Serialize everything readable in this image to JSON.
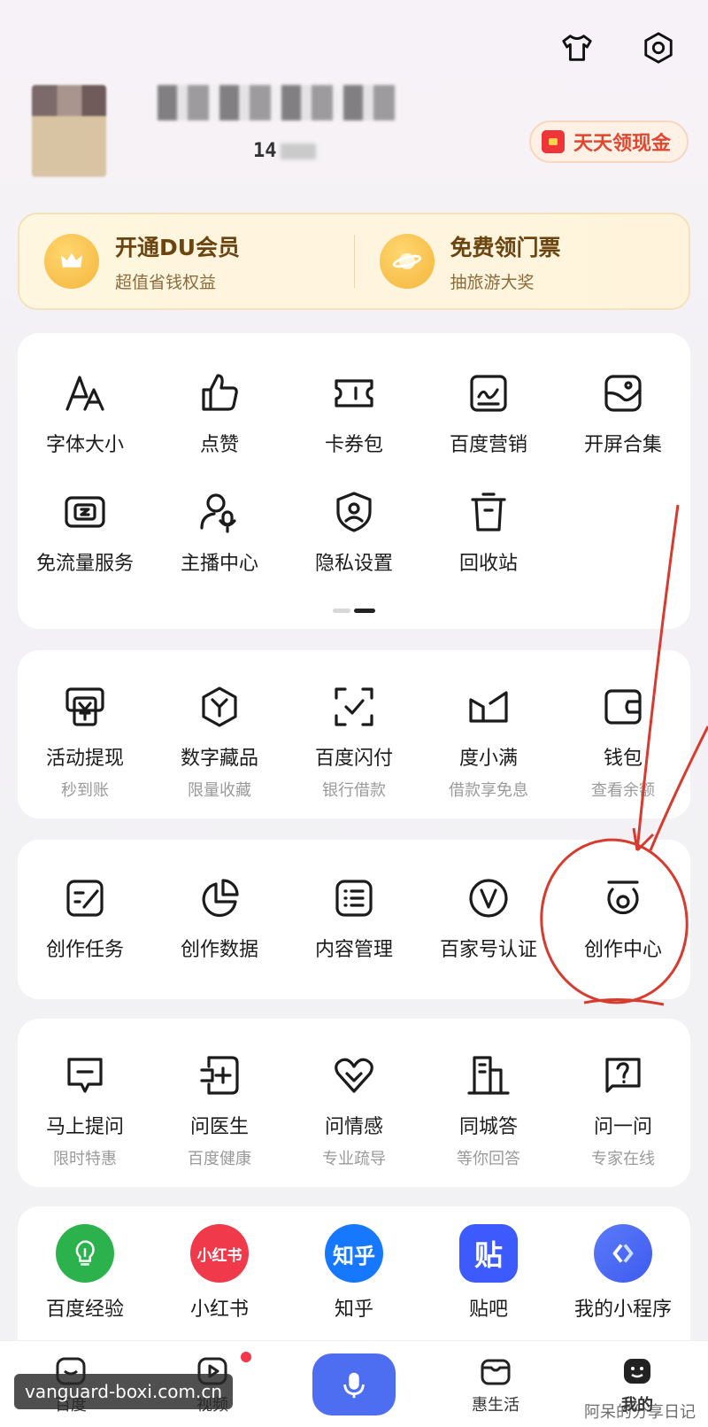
{
  "header": {
    "user_id": "14",
    "cash_button": "天天领现金"
  },
  "member": {
    "left": {
      "title": "开通DU会员",
      "subtitle": "超值省钱权益"
    },
    "right": {
      "title": "免费领门票",
      "subtitle": "抽旅游大奖"
    }
  },
  "tools": {
    "items": [
      {
        "label": "字体大小",
        "icon": "font-size-icon"
      },
      {
        "label": "点赞",
        "icon": "thumbs-up-icon"
      },
      {
        "label": "卡券包",
        "icon": "ticket-icon"
      },
      {
        "label": "百度营销",
        "icon": "marketing-icon"
      },
      {
        "label": "开屏合集",
        "icon": "splash-collection-icon"
      },
      {
        "label": "免流量服务",
        "icon": "free-data-icon"
      },
      {
        "label": "主播中心",
        "icon": "anchor-center-icon"
      },
      {
        "label": "隐私设置",
        "icon": "privacy-shield-icon"
      },
      {
        "label": "回收站",
        "icon": "trash-icon"
      }
    ]
  },
  "finance": {
    "items": [
      {
        "label": "活动提现",
        "sub": "秒到账",
        "icon": "withdraw-icon"
      },
      {
        "label": "数字藏品",
        "sub": "限量收藏",
        "icon": "digital-collectible-icon"
      },
      {
        "label": "百度闪付",
        "sub": "银行借款",
        "icon": "flash-pay-icon"
      },
      {
        "label": "度小满",
        "sub": "借款享免息",
        "icon": "duxiaoman-icon"
      },
      {
        "label": "钱包",
        "sub": "查看余额",
        "icon": "wallet-icon"
      }
    ]
  },
  "creator": {
    "items": [
      {
        "label": "创作任务",
        "icon": "creation-task-icon"
      },
      {
        "label": "创作数据",
        "icon": "creation-data-icon"
      },
      {
        "label": "内容管理",
        "icon": "content-management-icon"
      },
      {
        "label": "百家号认证",
        "icon": "baijiahao-verify-icon"
      },
      {
        "label": "创作中心",
        "icon": "creation-center-icon"
      }
    ]
  },
  "ask": {
    "items": [
      {
        "label": "马上提问",
        "sub": "限时特惠",
        "icon": "ask-now-icon"
      },
      {
        "label": "问医生",
        "sub": "百度健康",
        "icon": "doctor-icon"
      },
      {
        "label": "问情感",
        "sub": "专业疏导",
        "icon": "heart-icon"
      },
      {
        "label": "同城答",
        "sub": "等你回答",
        "icon": "city-icon"
      },
      {
        "label": "问一问",
        "sub": "专家在线",
        "icon": "question-icon"
      }
    ]
  },
  "apps": {
    "items": [
      {
        "label": "百度经验",
        "glyph": "",
        "color": "#2bb24c"
      },
      {
        "label": "小红书",
        "glyph": "小红书",
        "color": "#f0394a"
      },
      {
        "label": "知乎",
        "glyph": "知乎",
        "color": "#1677ff"
      },
      {
        "label": "贴吧",
        "glyph": "贴",
        "color": "#3d5afe"
      },
      {
        "label": "我的小程序",
        "glyph": "",
        "color": "#4a6cf7"
      }
    ]
  },
  "bottom_nav": {
    "items": [
      {
        "label": "百度"
      },
      {
        "label": "视频"
      },
      {
        "label": ""
      },
      {
        "label": "惠生活"
      },
      {
        "label": "我的"
      }
    ]
  },
  "watermark": "vanguard-boxi.com.cn",
  "watermark2": "阿呆的分享日记"
}
